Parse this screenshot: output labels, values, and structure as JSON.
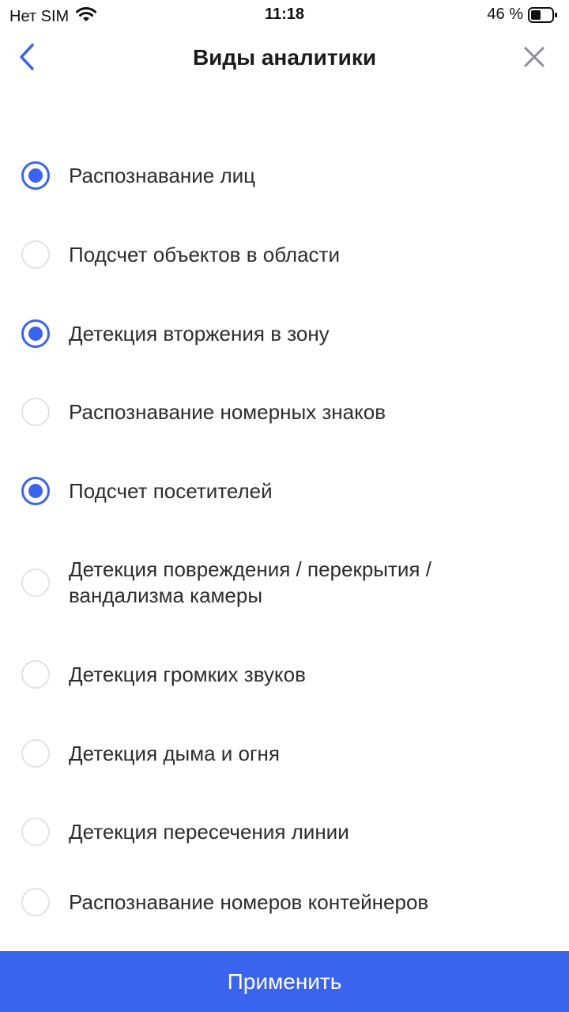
{
  "status_bar": {
    "carrier": "Нет SIM",
    "time": "11:18",
    "battery_text": "46 %",
    "battery_level": 0.46,
    "icons": [
      "wifi-icon",
      "battery-icon"
    ]
  },
  "header": {
    "title": "Виды аналитики",
    "back_icon": "chevron-left-icon",
    "close_icon": "close-icon"
  },
  "options": [
    {
      "label": "Распознавание лиц",
      "checked": true
    },
    {
      "label": "Подсчет объектов в области",
      "checked": false
    },
    {
      "label": "Детекция вторжения в зону",
      "checked": true
    },
    {
      "label": "Распознавание номерных знаков",
      "checked": false
    },
    {
      "label": "Подсчет посетителей",
      "checked": true
    },
    {
      "label": "Детекция повреждения / перекрытия / вандализма камеры",
      "checked": false
    },
    {
      "label": "Детекция громких звуков",
      "checked": false
    },
    {
      "label": "Детекция дыма и огня",
      "checked": false
    },
    {
      "label": "Детекция пересечения линии",
      "checked": false
    },
    {
      "label": "Распознавание номеров контейнеров",
      "checked": false
    }
  ],
  "footer": {
    "apply_label": "Применить"
  },
  "colors": {
    "accent": "#3b64ee",
    "radio_border": "#e3e3e3",
    "text": "#2d2d2d"
  }
}
